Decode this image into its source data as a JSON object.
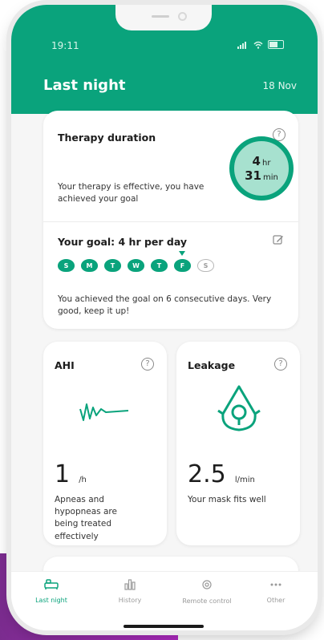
{
  "status": {
    "time": "19:11"
  },
  "header": {
    "title": "Last night",
    "date": "18 Nov"
  },
  "therapy": {
    "title": "Therapy duration",
    "hours": "4",
    "hours_unit": "hr",
    "minutes": "31",
    "minutes_unit": "min",
    "message": "Your therapy is effective, you have achieved your goal"
  },
  "goal": {
    "title": "Your goal: 4 hr per day",
    "days": [
      {
        "label": "S",
        "achieved": true
      },
      {
        "label": "M",
        "achieved": true
      },
      {
        "label": "T",
        "achieved": true
      },
      {
        "label": "W",
        "achieved": true
      },
      {
        "label": "T",
        "achieved": true
      },
      {
        "label": "F",
        "achieved": true,
        "current": true
      },
      {
        "label": "S",
        "achieved": false
      }
    ],
    "message": "You achieved the goal on 6 consecutive days. Very good, keep it up!"
  },
  "ahi": {
    "title": "AHI",
    "value": "1",
    "unit": "/h",
    "message": "Apneas and hypopneas are being treated effectively"
  },
  "leakage": {
    "title": "Leakage",
    "value": "2.5",
    "unit": "l/min",
    "message": "Your mask fits well"
  },
  "tabs": [
    {
      "label": "Last night",
      "icon": "bed-icon",
      "active": true
    },
    {
      "label": "History",
      "icon": "bar-chart-icon",
      "active": false
    },
    {
      "label": "Remote control",
      "icon": "settings-icon",
      "active": false
    },
    {
      "label": "Other",
      "icon": "more-icon",
      "active": false
    }
  ],
  "colors": {
    "accent": "#0aa37c",
    "ring_fill": "#a7e1cf",
    "background_band": "#b02bc2"
  }
}
